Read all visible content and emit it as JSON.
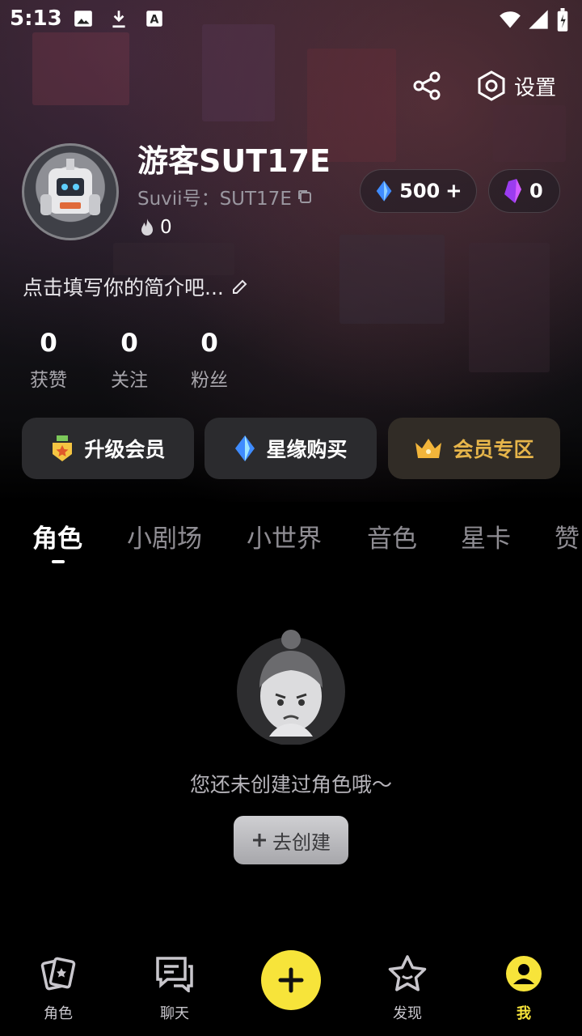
{
  "status_bar": {
    "time": "5:13",
    "icons": [
      "image-icon",
      "download-icon",
      "a-icon",
      "wifi-icon",
      "signal-icon",
      "battery-icon"
    ]
  },
  "header": {
    "share_icon": "share-icon",
    "settings_label": "设置"
  },
  "profile": {
    "username": "游客SUT17E",
    "uid_text": "Suvii号：SUT17E",
    "fire_count": "0",
    "gem_balance": "500",
    "crystal_balance": "0",
    "bio_placeholder": "点击填写你的简介吧..."
  },
  "stats": [
    {
      "value": "0",
      "label": "获赞"
    },
    {
      "value": "0",
      "label": "关注"
    },
    {
      "value": "0",
      "label": "粉丝"
    }
  ],
  "actions": [
    {
      "label": "升级会员",
      "icon": "medal-icon"
    },
    {
      "label": "星缘购买",
      "icon": "diamond-icon"
    },
    {
      "label": "会员专区",
      "icon": "crown-icon"
    }
  ],
  "tabs": [
    {
      "label": "角色",
      "active": true
    },
    {
      "label": "小剧场",
      "active": false
    },
    {
      "label": "小世界",
      "active": false
    },
    {
      "label": "音色",
      "active": false
    },
    {
      "label": "星卡",
      "active": false
    },
    {
      "label": "赞",
      "active": false
    }
  ],
  "empty_state": {
    "message": "您还未创建过角色哦～",
    "button_label": "去创建"
  },
  "bottom_nav": [
    {
      "label": "角色",
      "icon": "card-icon",
      "active": false
    },
    {
      "label": "聊天",
      "icon": "chat-icon",
      "active": false
    },
    {
      "label": "",
      "icon": "plus-icon",
      "active": false
    },
    {
      "label": "发现",
      "icon": "star-icon",
      "active": false
    },
    {
      "label": "我",
      "icon": "user-icon",
      "active": true
    }
  ],
  "colors": {
    "accent_yellow": "#f7e43a",
    "vip_gold": "#e6b54a",
    "background": "#000000"
  }
}
